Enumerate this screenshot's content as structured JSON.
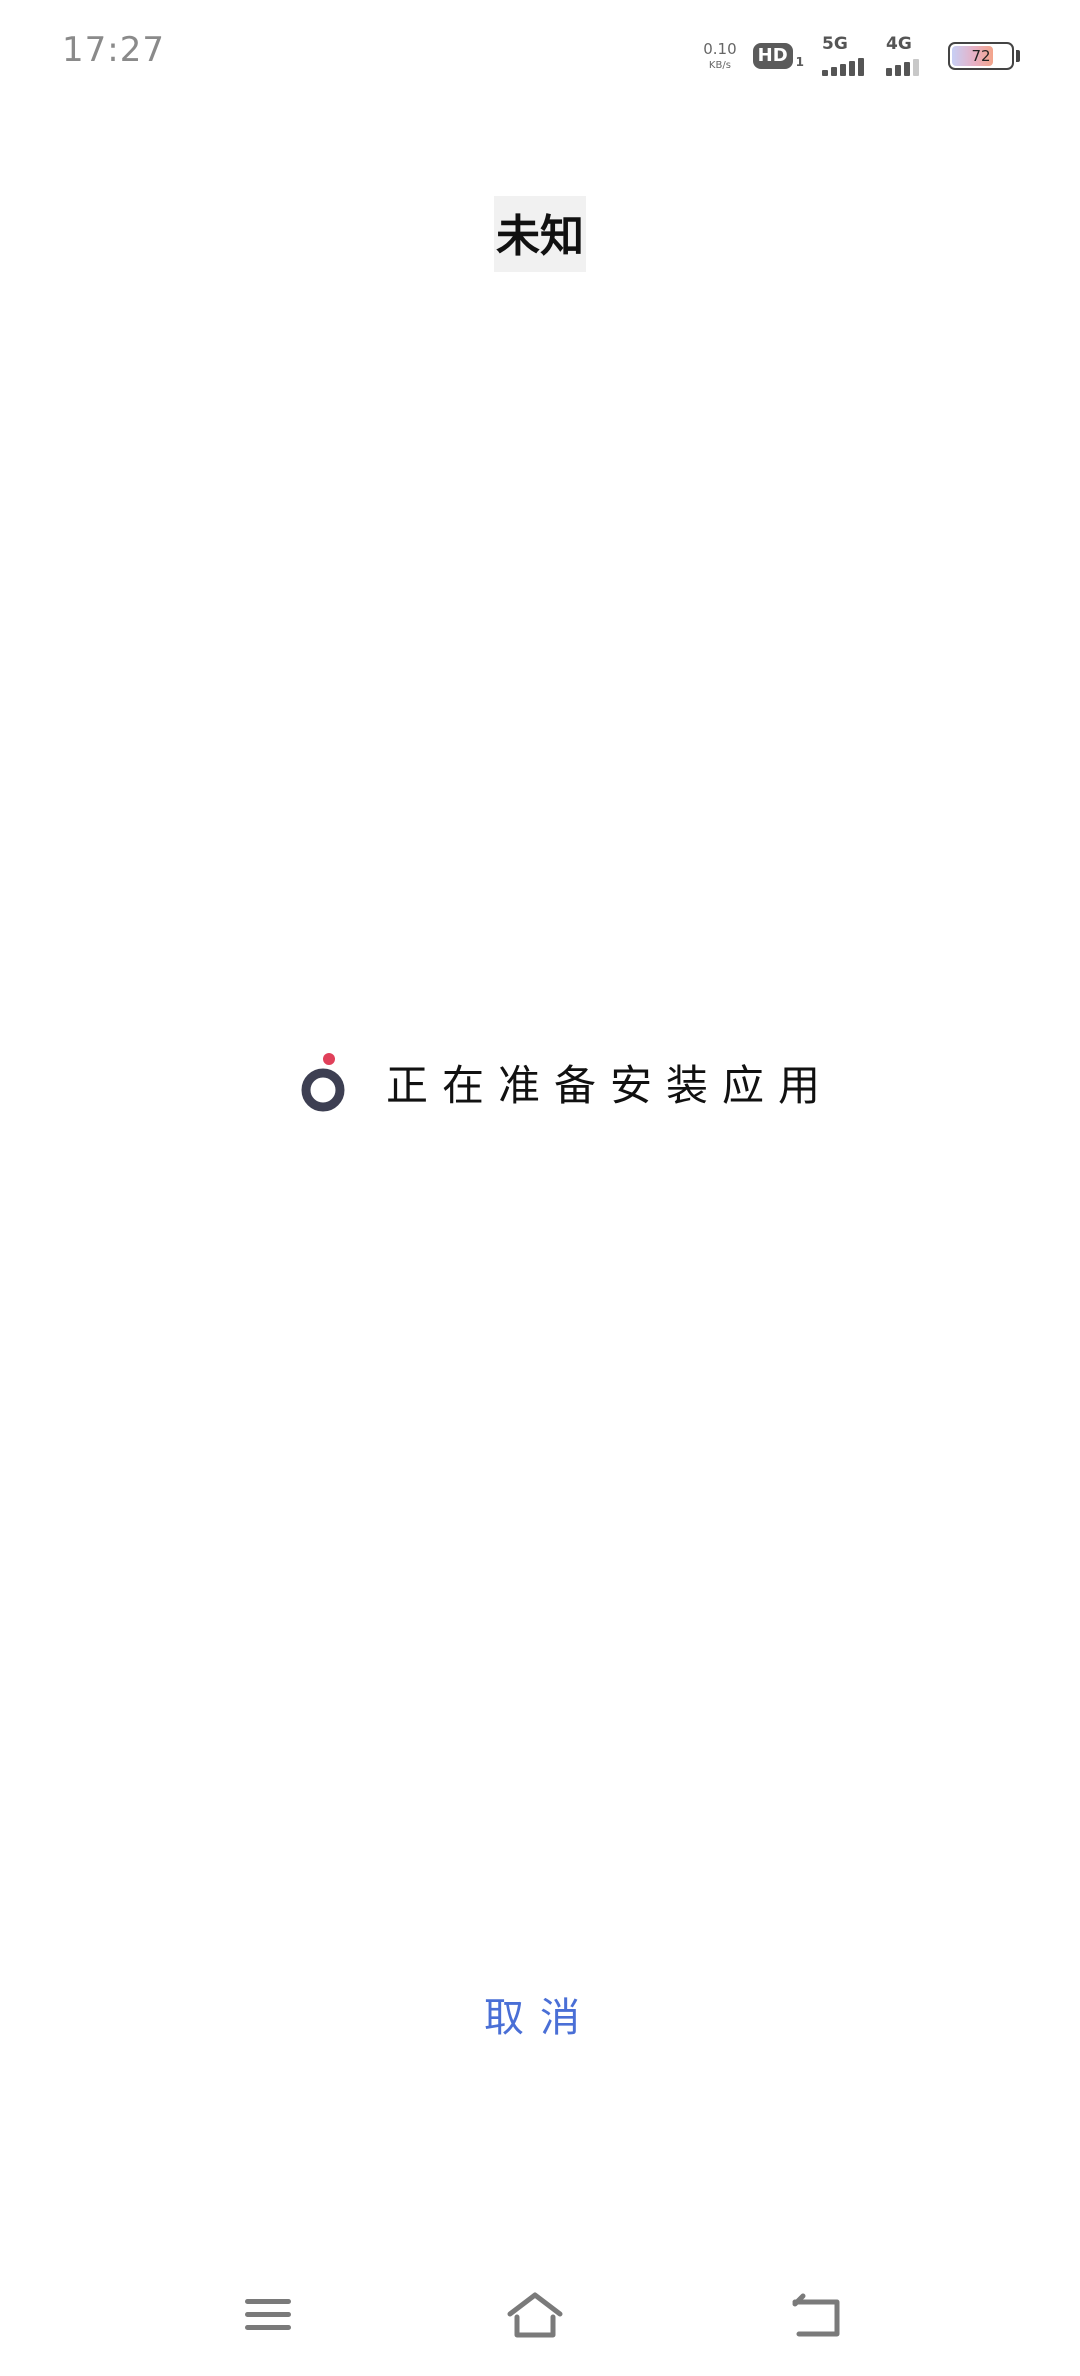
{
  "status_bar": {
    "time": "17:27",
    "net_speed_value": "0.10",
    "net_speed_unit": "KB/s",
    "hd_label": "HD",
    "hd_sub": "1",
    "sim1_network": "5G",
    "sim2_network": "4G",
    "battery_level": "72",
    "battery_fraction": 0.72,
    "icons": [
      "hd-voice-icon",
      "signal-5g-icon",
      "signal-4g-icon",
      "battery-icon"
    ]
  },
  "header": {
    "title": "未知"
  },
  "progress": {
    "message": "正在准备安装应用",
    "icon": "loading-spinner-icon",
    "colors": {
      "ring": "#3d3f52",
      "dot": "#e0405a"
    }
  },
  "actions": {
    "cancel_label": "取消",
    "cancel_color": "#4a6fd6"
  },
  "nav_bar": {
    "items": [
      "menu-icon",
      "home-icon",
      "back-icon"
    ]
  }
}
